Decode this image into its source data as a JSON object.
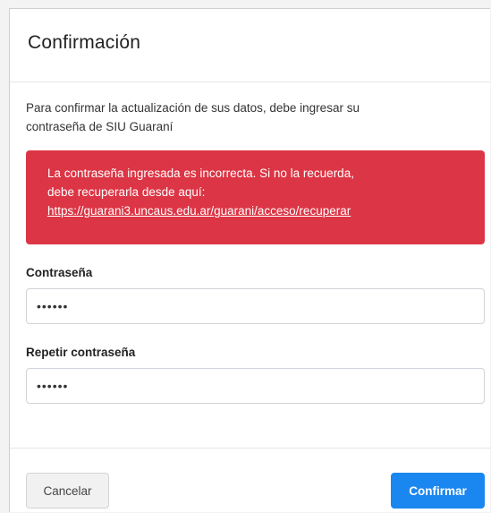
{
  "modal": {
    "title": "Confirmación",
    "intro_line1": "Para confirmar la actualización de sus datos, debe ingresar su",
    "intro_line2": "contraseña de SIU Guaraní"
  },
  "alert": {
    "line1": "La contraseña ingresada es incorrecta. Si no la recuerda,",
    "line2": "debe recuperarla desde aquí:",
    "link": "https://guarani3.uncaus.edu.ar/guarani/acceso/recuperar",
    "color": "#dc3545"
  },
  "form": {
    "password_label": "Contraseña",
    "password_value": "••••••",
    "repeat_label": "Repetir contraseña",
    "repeat_value": "••••••"
  },
  "footer": {
    "cancel_label": "Cancelar",
    "confirm_label": "Confirmar",
    "confirm_color": "#1a86f0"
  }
}
